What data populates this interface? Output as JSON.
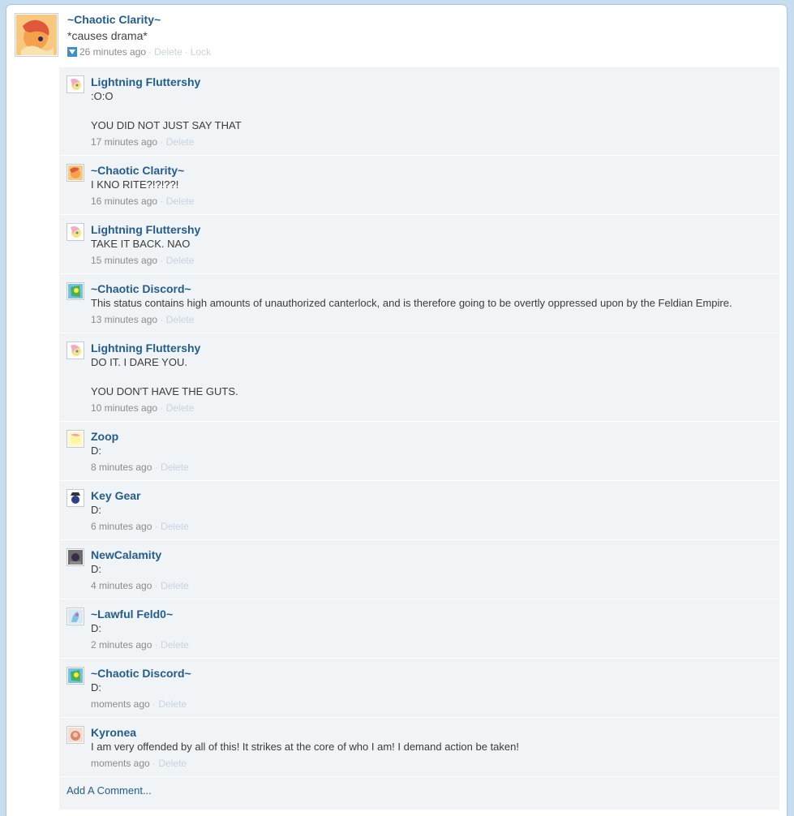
{
  "status": {
    "author": "~Chaotic Clarity~",
    "text": "*causes drama*",
    "time": "26 minutes ago",
    "delete_label": "Delete",
    "lock_label": "Lock"
  },
  "comments": [
    {
      "author": "Lightning Fluttershy",
      "text": ":O:O\n\nYOU DID NOT JUST SAY THAT",
      "time": "17 minutes ago",
      "delete_label": "Delete"
    },
    {
      "author": "~Chaotic Clarity~",
      "text": "I KNO RITE?!?!??!",
      "time": "16 minutes ago",
      "delete_label": "Delete"
    },
    {
      "author": "Lightning Fluttershy",
      "text": "TAKE IT BACK. NAO",
      "time": "15 minutes ago",
      "delete_label": "Delete"
    },
    {
      "author": "~Chaotic Discord~",
      "text": "This status contains high amounts of unauthorized canterlock, and is therefore going to be overtly oppressed upon by the Feldian Empire.",
      "time": "13 minutes ago",
      "delete_label": "Delete"
    },
    {
      "author": "Lightning Fluttershy",
      "text": "DO IT. I DARE YOU.\n\nYOU DON'T HAVE THE GUTS.",
      "time": "10 minutes ago",
      "delete_label": "Delete"
    },
    {
      "author": "Zoop",
      "text": "D:",
      "time": "8 minutes ago",
      "delete_label": "Delete"
    },
    {
      "author": "Key Gear",
      "text": "D:",
      "time": "6 minutes ago",
      "delete_label": "Delete"
    },
    {
      "author": "NewCalamity",
      "text": "D:",
      "time": "4 minutes ago",
      "delete_label": "Delete"
    },
    {
      "author": "~Lawful Feld0~",
      "text": "D:",
      "time": "2 minutes ago",
      "delete_label": "Delete"
    },
    {
      "author": "~Chaotic Discord~",
      "text": "D:",
      "time": "moments ago",
      "delete_label": "Delete"
    },
    {
      "author": "Kyronea",
      "text": "I am very offended by all of this! It strikes at the core of who I am! I demand action be taken!",
      "time": "moments ago",
      "delete_label": "Delete"
    }
  ],
  "add_comment_label": "Add A Comment...",
  "colors": {
    "link": "#245c8c",
    "comment_bg": "#f0f4f7",
    "page_bg": "#c6dcef"
  },
  "icons": {
    "like": "like-icon",
    "avatar": "avatar-icon"
  }
}
